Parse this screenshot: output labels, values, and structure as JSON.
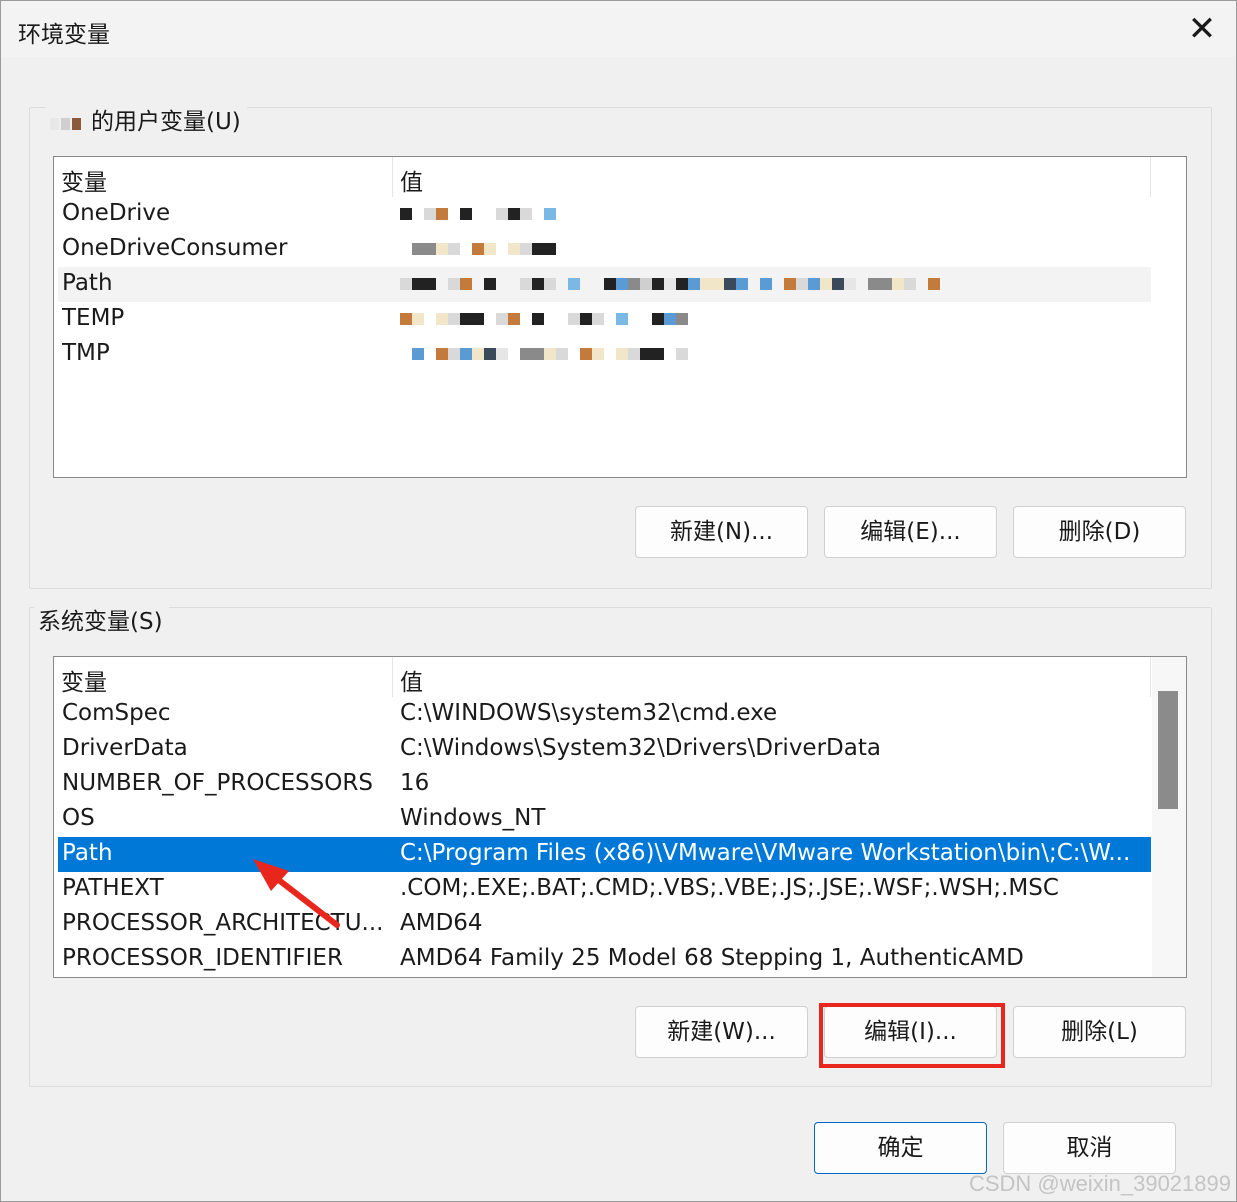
{
  "window": {
    "title": "环境变量",
    "close_glyph": "✕"
  },
  "user_group": {
    "legend": "的用户变量(U)",
    "header": {
      "variable": "变量",
      "value": "值"
    },
    "rows": [
      {
        "name": "OneDrive",
        "value": ""
      },
      {
        "name": "OneDriveConsumer",
        "value": ""
      },
      {
        "name": "Path",
        "value": ""
      },
      {
        "name": "TEMP",
        "value": ""
      },
      {
        "name": "TMP",
        "value": ""
      }
    ],
    "buttons": {
      "new": "新建(N)...",
      "edit": "编辑(E)...",
      "delete": "删除(D)"
    }
  },
  "system_group": {
    "legend": "系统变量(S)",
    "header": {
      "variable": "变量",
      "value": "值"
    },
    "rows": [
      {
        "name": "ComSpec",
        "value": "C:\\WINDOWS\\system32\\cmd.exe"
      },
      {
        "name": "DriverData",
        "value": "C:\\Windows\\System32\\Drivers\\DriverData"
      },
      {
        "name": "NUMBER_OF_PROCESSORS",
        "value": "16"
      },
      {
        "name": "OS",
        "value": "Windows_NT"
      },
      {
        "name": "Path",
        "value": "C:\\Program Files (x86)\\VMware\\VMware Workstation\\bin\\;C:\\W..."
      },
      {
        "name": "PATHEXT",
        "value": ".COM;.EXE;.BAT;.CMD;.VBS;.VBE;.JS;.JSE;.WSF;.WSH;.MSC"
      },
      {
        "name": "PROCESSOR_ARCHITECTU...",
        "value": "AMD64"
      },
      {
        "name": "PROCESSOR_IDENTIFIER",
        "value": "AMD64 Family 25 Model 68 Stepping 1, AuthenticAMD"
      }
    ],
    "buttons": {
      "new": "新建(W)...",
      "edit": "编辑(I)...",
      "delete": "删除(L)"
    }
  },
  "footer": {
    "ok": "确定",
    "cancel": "取消"
  },
  "watermark": "CSDN @weixin_39021899",
  "colors": {
    "selection": "#0078d7",
    "annotation": "#e8261b"
  }
}
